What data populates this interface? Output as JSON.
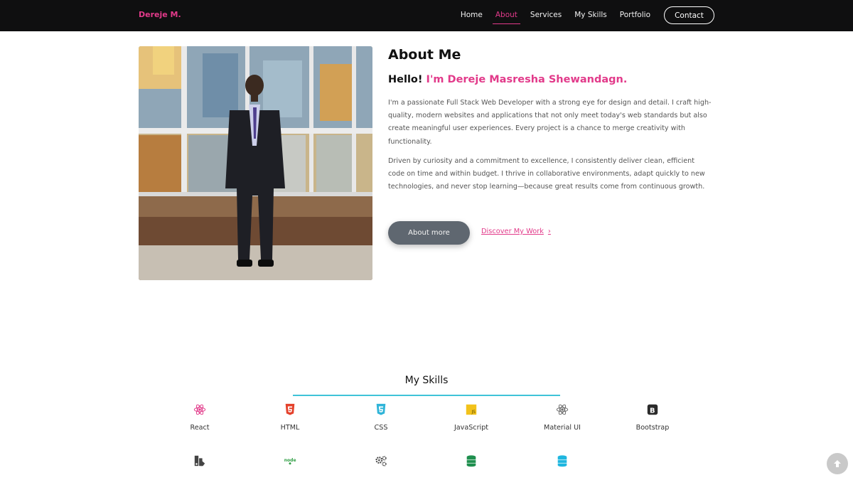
{
  "nav": {
    "brand": "Dereje M.",
    "links": [
      {
        "label": "Home",
        "active": false
      },
      {
        "label": "About",
        "active": true
      },
      {
        "label": "Services",
        "active": false
      },
      {
        "label": "My Skills",
        "active": false
      },
      {
        "label": "Portfolio",
        "active": false
      }
    ],
    "contact_label": "Contact"
  },
  "about": {
    "title": "About Me",
    "hello_prefix": "Hello!",
    "hello_name": "I'm Dereje Masresha Shewandagn.",
    "paragraph1": "I'm a passionate Full Stack Web Developer with a strong eye for design and detail. I craft high-quality, modern websites and applications that not only meet today's web standards but also create meaningful user experiences. Every project is a chance to merge creativity with functionality.",
    "paragraph2": "Driven by curiosity and a commitment to excellence, I consistently deliver clean, efficient code on time and within budget. I thrive in collaborative environments, adapt quickly to new technologies, and never stop learning—because great results come from continuous growth.",
    "about_more_label": "About more",
    "discover_label": "Discover My Work"
  },
  "skills": {
    "title": "My Skills",
    "row1": [
      {
        "label": "React",
        "icon": "react-icon"
      },
      {
        "label": "HTML",
        "icon": "html5-icon"
      },
      {
        "label": "CSS",
        "icon": "css3-icon"
      },
      {
        "label": "JavaScript",
        "icon": "javascript-icon"
      },
      {
        "label": "Material UI",
        "icon": "material-ui-icon"
      },
      {
        "label": "Bootstrap",
        "icon": "bootstrap-icon"
      }
    ],
    "row2": [
      {
        "icon": "tailwind-icon"
      },
      {
        "icon": "nodejs-icon"
      },
      {
        "icon": "gears-icon"
      },
      {
        "icon": "mongodb-database-icon"
      },
      {
        "icon": "sql-database-icon"
      }
    ]
  },
  "colors": {
    "accent": "#e23a8a",
    "navbar_bg": "#0f0f10",
    "skills_underline": "#3fc3d8",
    "button_gray": "#5f6770"
  }
}
